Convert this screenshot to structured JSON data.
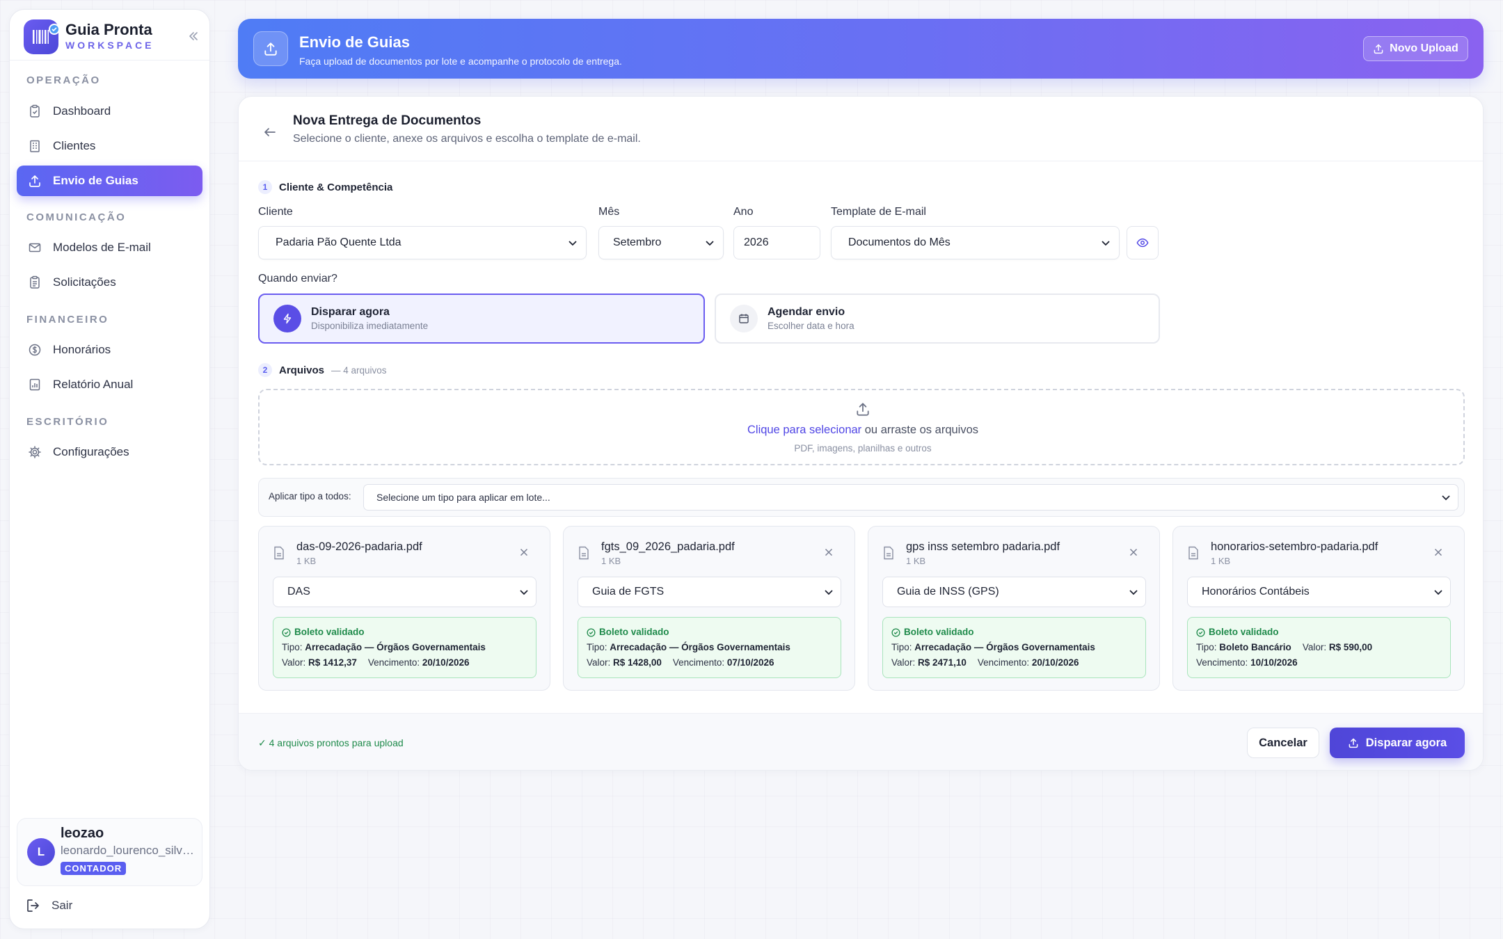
{
  "brand": {
    "title": "Guia Pronta",
    "subtitle": "WORKSPACE"
  },
  "sidebar": {
    "sections": [
      {
        "label": "OPERAÇÃO"
      },
      {
        "label": "COMUNICAÇÃO"
      },
      {
        "label": "FINANCEIRO"
      },
      {
        "label": "ESCRITÓRIO"
      }
    ],
    "items": [
      {
        "label": "Dashboard",
        "icon": "clipboard-check-icon"
      },
      {
        "label": "Clientes",
        "icon": "building-icon"
      },
      {
        "label": "Envio de Guias",
        "icon": "upload-icon",
        "active": true
      },
      {
        "label": "Modelos de E-mail",
        "icon": "mail-icon"
      },
      {
        "label": "Solicitações",
        "icon": "clipboard-list-icon"
      },
      {
        "label": "Honorários",
        "icon": "dollar-circle-icon"
      },
      {
        "label": "Relatório Anual",
        "icon": "report-icon"
      },
      {
        "label": "Configurações",
        "icon": "gear-icon"
      }
    ],
    "user": {
      "initial": "L",
      "name": "leozao",
      "email": "leonardo_lourenco_silva@outlook.com",
      "role": "CONTADOR"
    },
    "logout_label": "Sair"
  },
  "header": {
    "title": "Envio de Guias",
    "subtitle": "Faça upload de documentos por lote e acompanhe o protocolo de entrega.",
    "new_upload_label": "Novo Upload"
  },
  "form": {
    "title": "Nova Entrega de Documentos",
    "subtitle": "Selecione o cliente, anexe os arquivos e escolha o template de e-mail.",
    "step1": {
      "number": "1",
      "label": "Cliente & Competência"
    },
    "client": {
      "label": "Cliente",
      "value": "Padaria Pão Quente Ltda"
    },
    "month": {
      "label": "Mês",
      "value": "Setembro"
    },
    "year": {
      "label": "Ano",
      "value": "2026"
    },
    "template": {
      "label": "Template de E-mail",
      "value": "Documentos do Mês"
    },
    "when": {
      "label": "Quando enviar?",
      "now": {
        "title": "Disparar agora",
        "subtitle": "Disponibiliza imediatamente",
        "selected": true
      },
      "schedule": {
        "title": "Agendar envio",
        "subtitle": "Escolher data e hora"
      }
    },
    "step2": {
      "number": "2",
      "label": "Arquivos",
      "count": "— 4 arquivos"
    },
    "dropzone": {
      "link": "Clique para selecionar",
      "rest": " ou arraste os arquivos",
      "hint": "PDF, imagens, planilhas e outros"
    },
    "bulk": {
      "label": "Aplicar tipo a todos:",
      "placeholder": "Selecione um tipo para aplicar em lote..."
    },
    "files": [
      {
        "name": "das-09-2026-padaria.pdf",
        "size": "1 KB",
        "type": "DAS",
        "status": "Boleto validado",
        "tipo_label": "Tipo:",
        "tipo": "Arrecadação — Órgãos Governamentais",
        "valor_label": "Valor:",
        "valor": "R$ 1412,37",
        "venc_label": "Vencimento:",
        "venc": "20/10/2026"
      },
      {
        "name": "fgts_09_2026_padaria.pdf",
        "size": "1 KB",
        "type": "Guia de FGTS",
        "status": "Boleto validado",
        "tipo_label": "Tipo:",
        "tipo": "Arrecadação — Órgãos Governamentais",
        "valor_label": "Valor:",
        "valor": "R$ 1428,00",
        "venc_label": "Vencimento:",
        "venc": "07/10/2026"
      },
      {
        "name": "gps inss setembro padaria.pdf",
        "size": "1 KB",
        "type": "Guia de INSS (GPS)",
        "status": "Boleto validado",
        "tipo_label": "Tipo:",
        "tipo": "Arrecadação — Órgãos Governamentais",
        "valor_label": "Valor:",
        "valor": "R$ 2471,10",
        "venc_label": "Vencimento:",
        "venc": "20/10/2026"
      },
      {
        "name": "honorarios-setembro-padaria.pdf",
        "size": "1 KB",
        "type": "Honorários Contábeis",
        "status": "Boleto validado",
        "tipo_label": "Tipo:",
        "tipo": "Boleto Bancário",
        "valor_label": "Valor:",
        "valor": "R$ 590,00",
        "venc_label": "Vencimento:",
        "venc": "10/10/2026"
      }
    ],
    "footer": {
      "status": "✓ 4 arquivos prontos para upload",
      "cancel": "Cancelar",
      "submit": "Disparar agora"
    }
  },
  "colors": {
    "accent": "#5a5ef0",
    "success": "#1e8a4a",
    "header_start": "#4f7cf5",
    "header_end": "#8a62f0"
  }
}
